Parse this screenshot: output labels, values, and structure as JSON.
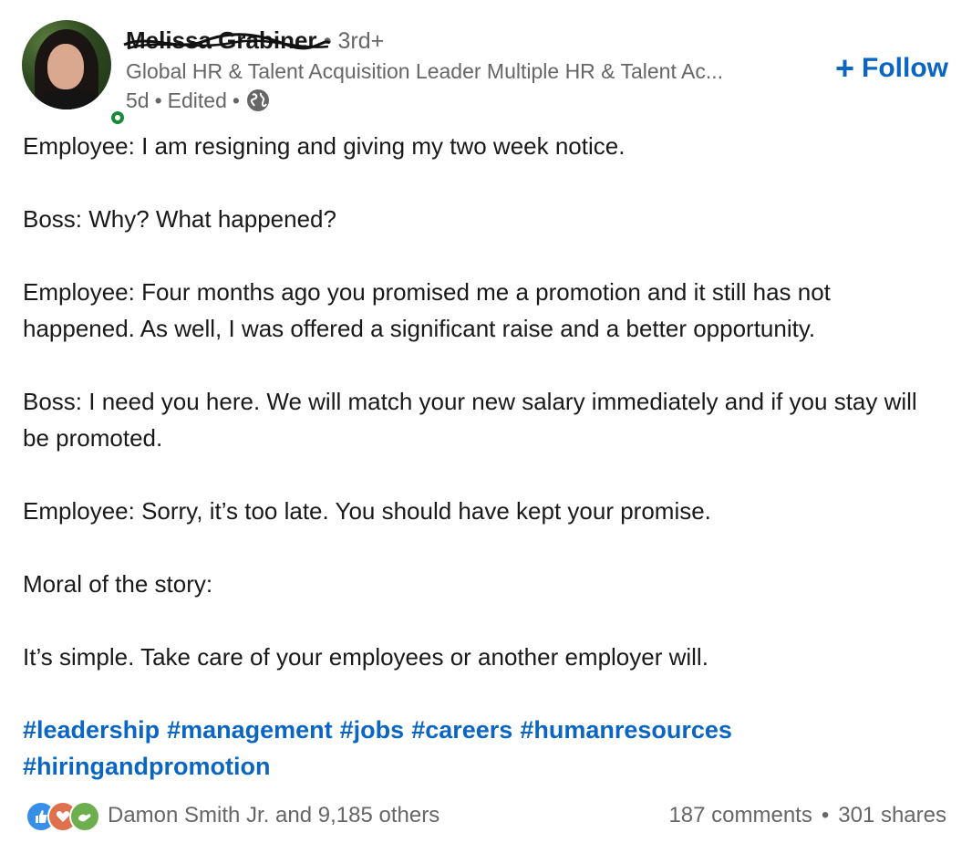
{
  "author": {
    "name": "Melissa Grabiner",
    "degree": "• 3rd+",
    "headline": "Global HR & Talent Acquisition Leader Multiple HR & Talent Ac...",
    "time": "5d",
    "edited": "Edited",
    "sep": "•"
  },
  "follow_label": "Follow",
  "post": {
    "paragraphs": [
      "Employee: I am resigning and giving my two week notice.",
      "Boss: Why? What happened?",
      "Employee: Four months ago you promised me a promotion and it still has not happened. As well, I was offered a significant raise and a better opportunity.",
      "Boss: I need you here. We will match your new salary immediately and if you stay will be promoted.",
      "Employee: Sorry, it’s too late. You should have kept your promise.",
      "Moral of the story:",
      "It’s simple. Take care of your employees or another employer will."
    ],
    "hashtags": [
      "#leadership",
      "#management",
      "#jobs",
      "#careers",
      "#humanresources",
      "#hiringandpromotion"
    ]
  },
  "social": {
    "reactions_text": "Damon Smith Jr. and 9,185 others",
    "comments": "187 comments",
    "dot": "•",
    "shares": "301 shares",
    "reaction_icons": [
      "like-icon",
      "love-icon",
      "support-icon"
    ]
  },
  "colors": {
    "link_blue": "#0a66c2",
    "online_green": "#1a8a3a"
  }
}
